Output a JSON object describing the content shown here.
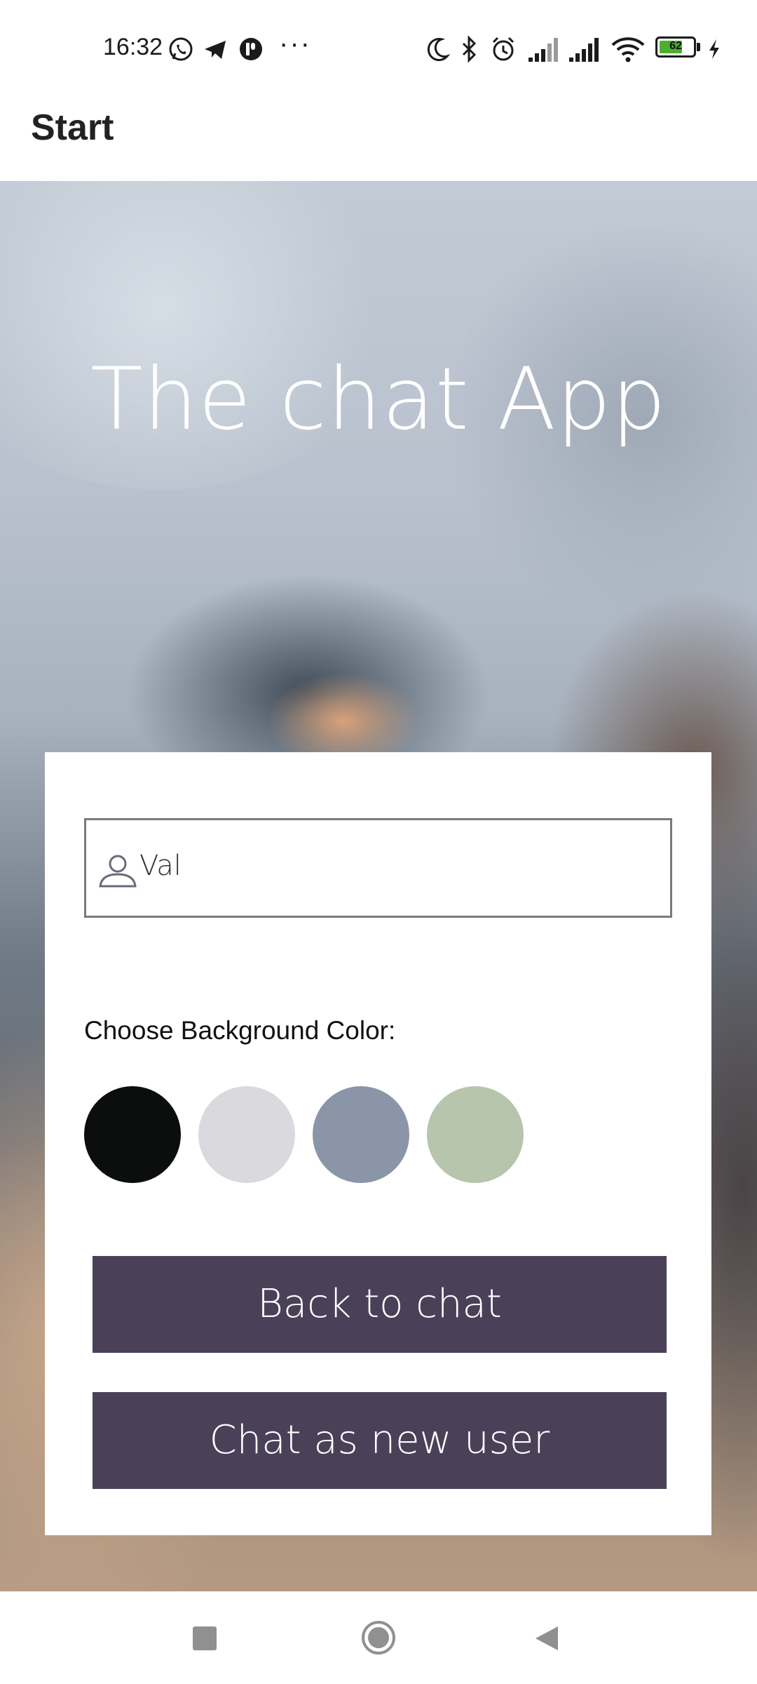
{
  "status_bar": {
    "time": "16:32",
    "notification_icons": [
      "whatsapp-icon",
      "telegram-icon",
      "app-notification-icon"
    ],
    "more_indicator": "···",
    "system_icons": [
      "moon-icon",
      "bluetooth-icon",
      "alarm-icon",
      "signal-icon",
      "signal-icon",
      "wifi-icon",
      "charging-icon"
    ],
    "battery_level": "62"
  },
  "header": {
    "title": "Start"
  },
  "hero": {
    "title": "The chat App"
  },
  "form": {
    "name_input": {
      "value": "Val",
      "icon": "person-icon"
    },
    "color_label": "Choose Background Color:",
    "colors": [
      "#0b0e0c",
      "#d9d9de",
      "#8a96a7",
      "#b6c5ab"
    ],
    "buttons": {
      "back_to_chat": "Back to chat",
      "new_user": "Chat as new user"
    },
    "button_color": "#4a4158"
  },
  "nav_bar": {
    "icons": [
      "recent-apps-icon",
      "home-icon",
      "back-icon"
    ]
  }
}
